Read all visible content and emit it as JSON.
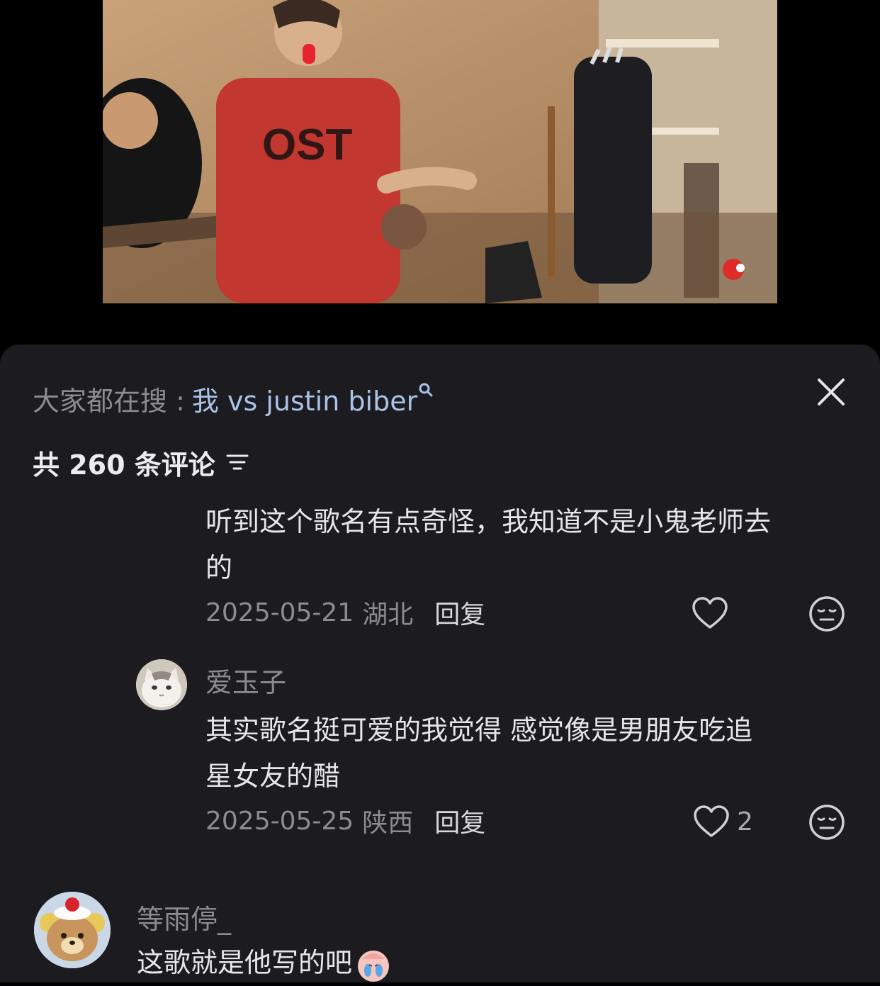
{
  "search_suggestion": {
    "prefix": "大家都在搜 :",
    "query": "我 vs justin biber"
  },
  "comments_header": {
    "count_text": "共 260 条评论"
  },
  "comments": [
    {
      "text_line1": "听到这个歌名有点奇怪，我知道不是小鬼老师去",
      "text_line2": "的",
      "date": "2025-05-21",
      "location": "湖北",
      "reply_label": "回复",
      "likes": ""
    },
    {
      "username": "爱玉子",
      "text_line1": "其实歌名挺可爱的我觉得 感觉像是男朋友吃追",
      "text_line2": "星女友的醋",
      "date": "2025-05-25",
      "location": "陕西",
      "reply_label": "回复",
      "likes": "2"
    },
    {
      "username": "等雨停_",
      "text_line1": "这歌就是他写的吧"
    }
  ],
  "icons": {
    "close": "close-icon",
    "search": "search-icon",
    "filter": "filter-icon",
    "like": "heart-icon",
    "dislike": "meh-face-icon"
  },
  "colors": {
    "sheet_bg": "#1b1b20",
    "link": "#a9c2e6",
    "muted": "#8b8b90"
  }
}
